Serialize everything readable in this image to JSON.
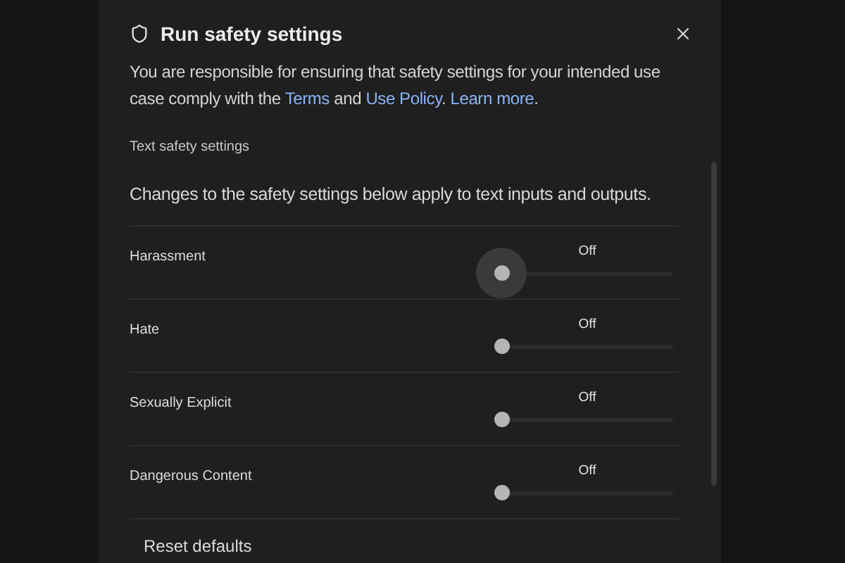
{
  "dialog": {
    "title": "Run safety settings",
    "intro": [
      {
        "kind": "text",
        "text": "You are responsible for ensuring that safety settings for your intended use case comply with the "
      },
      {
        "kind": "link",
        "text": "Terms"
      },
      {
        "kind": "text",
        "text": " and "
      },
      {
        "kind": "link",
        "text": "Use Policy"
      },
      {
        "kind": "text",
        "text": ". "
      },
      {
        "kind": "link",
        "text": "Learn more"
      },
      {
        "kind": "text",
        "text": "."
      }
    ],
    "section_title": "Text safety settings",
    "section_note": "Changes to the safety settings below apply to text inputs and outputs.",
    "settings": [
      {
        "name": "Harassment",
        "reading": "Off",
        "level": 0,
        "focused": true
      },
      {
        "name": "Hate",
        "reading": "Off",
        "level": 0,
        "focused": false
      },
      {
        "name": "Sexually Explicit",
        "reading": "Off",
        "level": 0,
        "focused": false
      },
      {
        "name": "Dangerous Content",
        "reading": "Off",
        "level": 0,
        "focused": false
      }
    ],
    "reset_button": "Reset defaults"
  }
}
